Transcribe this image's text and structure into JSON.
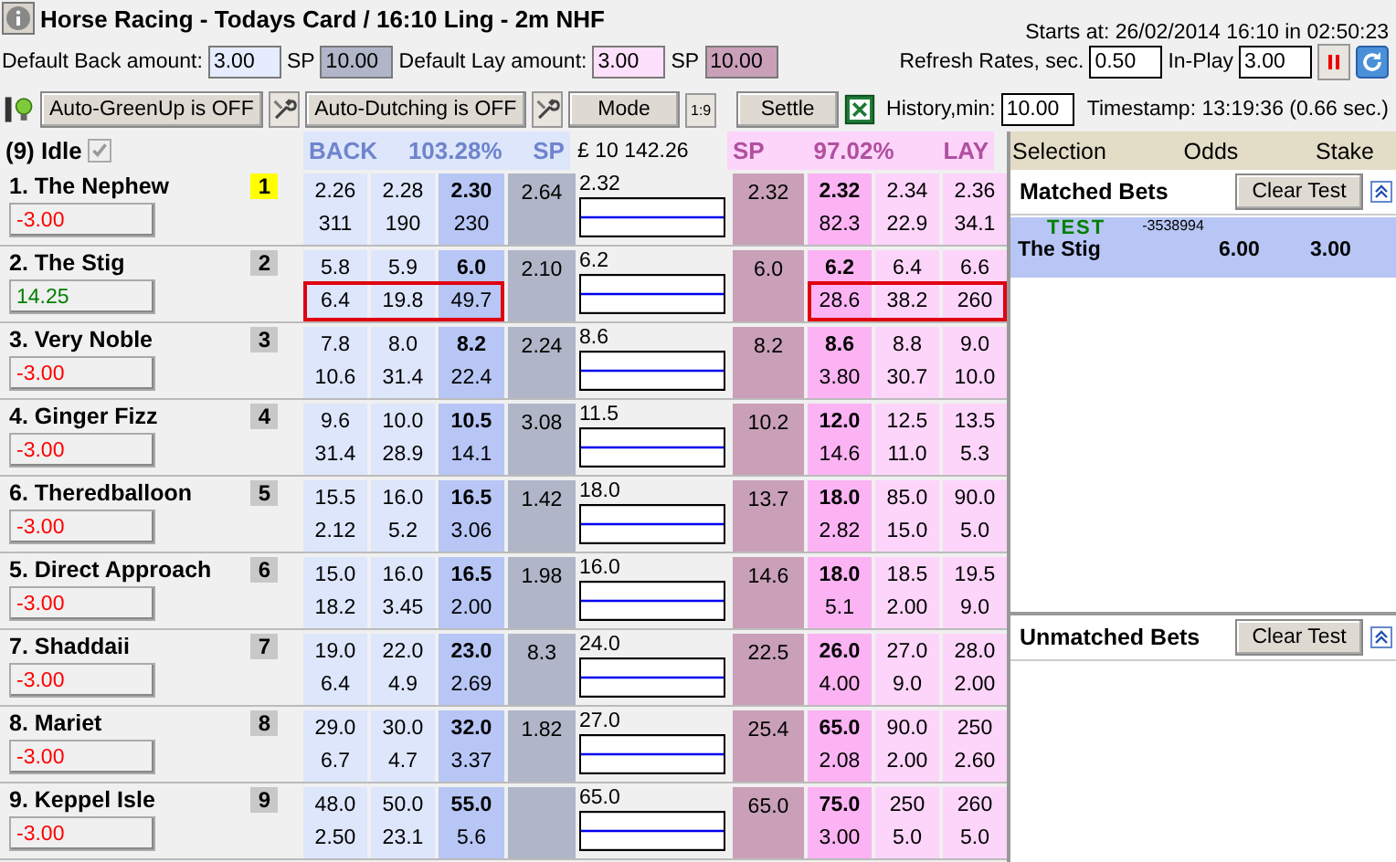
{
  "title": "Horse Racing - Todays Card / 16:10 Ling - 2m NHF",
  "starts_at": "Starts at: 26/02/2014 16:10 in 02:50:23",
  "amounts": [
    {
      "label": "Default Back amount:",
      "value": "3.00",
      "kind": "back"
    },
    {
      "label": "SP",
      "value": "10.00",
      "kind": "back-sp"
    },
    {
      "label": "Default Lay amount:",
      "value": "3.00",
      "kind": "lay"
    },
    {
      "label": "SP",
      "value": "10.00",
      "kind": "lay-sp"
    }
  ],
  "rates": [
    {
      "label": "Refresh Rates, sec.",
      "value": "0.50"
    },
    {
      "label": "In-Play",
      "value": "3.00"
    }
  ],
  "toolbar": {
    "greenup": "Auto-GreenUp is OFF",
    "dutching": "Auto-Dutching is OFF",
    "mode": "Mode",
    "ratio": "1:9",
    "settle": "Settle",
    "history_label": "History,min:",
    "history": "10.00",
    "timestamp": "Timestamp: 13:19:36 (0.66 sec.)"
  },
  "market": {
    "status": "(9) Idle",
    "idle_checked": true,
    "back_label": "BACK",
    "back_pct": "103.28%",
    "back_sp": "SP",
    "matched": "£ 10 142.26",
    "lay_sp": "SP",
    "lay_pct": "97.02%",
    "lay_label": "LAY"
  },
  "runners": [
    {
      "name": "1. The Nephew",
      "number": "1",
      "number_highlighted": true,
      "pl": {
        "text": "-3.00",
        "color": "#ff0000"
      },
      "highlighted": false,
      "back": [
        {
          "odds": "2.26",
          "size": "311"
        },
        {
          "odds": "2.28",
          "size": "190"
        },
        {
          "odds": "2.30",
          "size": "230"
        }
      ],
      "sp_back": "2.64",
      "last": "2.32",
      "sp_lay": "2.32",
      "lay": [
        {
          "odds": "2.32",
          "size": "82.3"
        },
        {
          "odds": "2.34",
          "size": "22.9"
        },
        {
          "odds": "2.36",
          "size": "34.1"
        }
      ]
    },
    {
      "name": "2. The Stig",
      "number": "2",
      "number_highlighted": false,
      "pl": {
        "text": "14.25",
        "color": "#008000"
      },
      "highlighted": true,
      "back": [
        {
          "odds": "5.8",
          "size": "6.4"
        },
        {
          "odds": "5.9",
          "size": "19.8"
        },
        {
          "odds": "6.0",
          "size": "49.7"
        }
      ],
      "sp_back": "2.10",
      "last": "6.2",
      "sp_lay": "6.0",
      "lay": [
        {
          "odds": "6.2",
          "size": "28.6"
        },
        {
          "odds": "6.4",
          "size": "38.2"
        },
        {
          "odds": "6.6",
          "size": "260"
        }
      ]
    },
    {
      "name": "3. Very Noble",
      "number": "3",
      "number_highlighted": false,
      "pl": {
        "text": "-3.00",
        "color": "#ff0000"
      },
      "highlighted": false,
      "back": [
        {
          "odds": "7.8",
          "size": "10.6"
        },
        {
          "odds": "8.0",
          "size": "31.4"
        },
        {
          "odds": "8.2",
          "size": "22.4"
        }
      ],
      "sp_back": "2.24",
      "last": "8.6",
      "sp_lay": "8.2",
      "lay": [
        {
          "odds": "8.6",
          "size": "3.80"
        },
        {
          "odds": "8.8",
          "size": "30.7"
        },
        {
          "odds": "9.0",
          "size": "10.0"
        }
      ]
    },
    {
      "name": "4. Ginger Fizz",
      "number": "4",
      "number_highlighted": false,
      "pl": {
        "text": "-3.00",
        "color": "#ff0000"
      },
      "highlighted": false,
      "back": [
        {
          "odds": "9.6",
          "size": "31.4"
        },
        {
          "odds": "10.0",
          "size": "28.9"
        },
        {
          "odds": "10.5",
          "size": "14.1"
        }
      ],
      "sp_back": "3.08",
      "last": "11.5",
      "sp_lay": "10.2",
      "lay": [
        {
          "odds": "12.0",
          "size": "14.6"
        },
        {
          "odds": "12.5",
          "size": "11.0"
        },
        {
          "odds": "13.5",
          "size": "5.3"
        }
      ]
    },
    {
      "name": "6. Theredballoon",
      "number": "5",
      "number_highlighted": false,
      "pl": {
        "text": "-3.00",
        "color": "#ff0000"
      },
      "highlighted": false,
      "back": [
        {
          "odds": "15.5",
          "size": "2.12"
        },
        {
          "odds": "16.0",
          "size": "5.2"
        },
        {
          "odds": "16.5",
          "size": "3.06"
        }
      ],
      "sp_back": "1.42",
      "last": "18.0",
      "sp_lay": "13.7",
      "lay": [
        {
          "odds": "18.0",
          "size": "2.82"
        },
        {
          "odds": "85.0",
          "size": "15.0"
        },
        {
          "odds": "90.0",
          "size": "5.0"
        }
      ]
    },
    {
      "name": "5. Direct Approach",
      "number": "6",
      "number_highlighted": false,
      "pl": {
        "text": "-3.00",
        "color": "#ff0000"
      },
      "highlighted": false,
      "back": [
        {
          "odds": "15.0",
          "size": "18.2"
        },
        {
          "odds": "16.0",
          "size": "3.45"
        },
        {
          "odds": "16.5",
          "size": "2.00"
        }
      ],
      "sp_back": "1.98",
      "last": "16.0",
      "sp_lay": "14.6",
      "lay": [
        {
          "odds": "18.0",
          "size": "5.1"
        },
        {
          "odds": "18.5",
          "size": "2.00"
        },
        {
          "odds": "19.5",
          "size": "9.0"
        }
      ]
    },
    {
      "name": "7. Shaddaii",
      "number": "7",
      "number_highlighted": false,
      "pl": {
        "text": "-3.00",
        "color": "#ff0000"
      },
      "highlighted": false,
      "back": [
        {
          "odds": "19.0",
          "size": "6.4"
        },
        {
          "odds": "22.0",
          "size": "4.9"
        },
        {
          "odds": "23.0",
          "size": "2.69"
        }
      ],
      "sp_back": "8.3",
      "last": "24.0",
      "sp_lay": "22.5",
      "lay": [
        {
          "odds": "26.0",
          "size": "4.00"
        },
        {
          "odds": "27.0",
          "size": "9.0"
        },
        {
          "odds": "28.0",
          "size": "2.00"
        }
      ]
    },
    {
      "name": "8. Mariet",
      "number": "8",
      "number_highlighted": false,
      "pl": {
        "text": "-3.00",
        "color": "#ff0000"
      },
      "highlighted": false,
      "back": [
        {
          "odds": "29.0",
          "size": "6.7"
        },
        {
          "odds": "30.0",
          "size": "4.7"
        },
        {
          "odds": "32.0",
          "size": "3.37"
        }
      ],
      "sp_back": "1.82",
      "last": "27.0",
      "sp_lay": "25.4",
      "lay": [
        {
          "odds": "65.0",
          "size": "2.08"
        },
        {
          "odds": "90.0",
          "size": "2.00"
        },
        {
          "odds": "250",
          "size": "2.60"
        }
      ]
    },
    {
      "name": "9. Keppel Isle",
      "number": "9",
      "number_highlighted": false,
      "pl": {
        "text": "-3.00",
        "color": "#ff0000"
      },
      "highlighted": false,
      "back": [
        {
          "odds": "48.0",
          "size": "2.50"
        },
        {
          "odds": "50.0",
          "size": "23.1"
        },
        {
          "odds": "55.0",
          "size": "5.6"
        }
      ],
      "last": "65.0",
      "sp_lay": "65.0",
      "lay": [
        {
          "odds": "75.0",
          "size": "3.00"
        },
        {
          "odds": "250",
          "size": "5.0"
        },
        {
          "odds": "260",
          "size": "5.0"
        }
      ]
    }
  ],
  "bets_panel": {
    "columns": [
      "Selection",
      "Odds",
      "Stake"
    ],
    "matched": {
      "title": "Matched Bets",
      "button": "Clear Test",
      "bets": [
        {
          "tag": "TEST",
          "id": "-3538994",
          "selection": "The Stig",
          "odds": "6.00",
          "stake": "3.00"
        }
      ]
    },
    "unmatched": {
      "title": "Unmatched Bets",
      "button": "Clear Test"
    }
  }
}
